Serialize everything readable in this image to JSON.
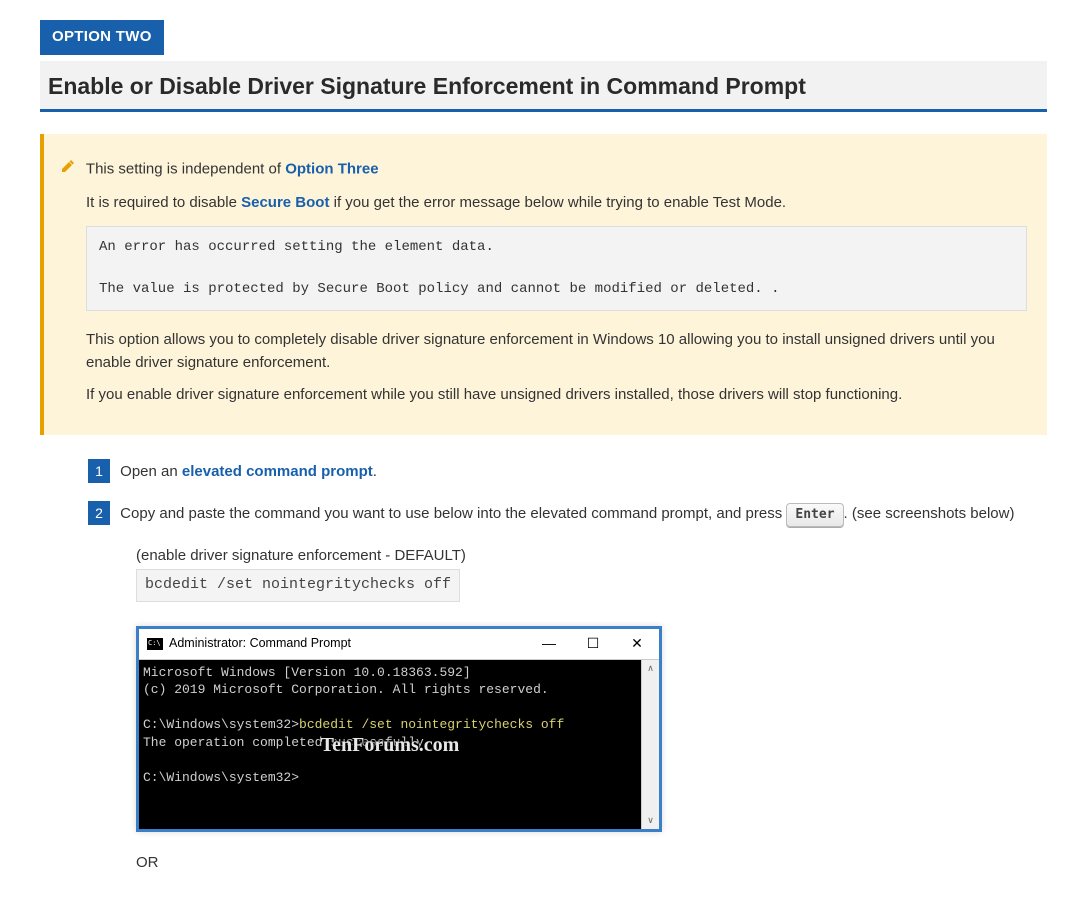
{
  "optionTag": "OPTION TWO",
  "heading": "Enable or Disable Driver Signature Enforcement in Command Prompt",
  "note": {
    "line1_a": "This setting is independent of ",
    "line1_link": "Option Three",
    "line2_a": "It is required to disable ",
    "line2_link": "Secure Boot",
    "line2_b": " if you get the error message below while trying to enable Test Mode.",
    "errorBox": "An error has occurred setting the element data.\n\nThe value is protected by Secure Boot policy and cannot be modified or deleted. .",
    "line3": "This option allows you to completely disable driver signature enforcement in Windows 10 allowing you to install unsigned drivers until you enable driver signature enforcement.",
    "line4": "If you enable driver signature enforcement while you still have unsigned drivers installed, those drivers will stop functioning."
  },
  "steps": {
    "s1_num": "1",
    "s1_a": "Open an ",
    "s1_link": "elevated command prompt",
    "s1_b": ".",
    "s2_num": "2",
    "s2_a": "Copy and paste the command you want to use below into the elevated command prompt, and press ",
    "s2_key": "Enter",
    "s2_b": ". (see screenshots below)"
  },
  "command1": {
    "label": "(enable driver signature enforcement - DEFAULT)",
    "code": "bcdedit /set nointegritychecks off"
  },
  "cmdWindow": {
    "title": "Administrator: Command Prompt",
    "line1": "Microsoft Windows [Version 10.0.18363.592]",
    "line2": "(c) 2019 Microsoft Corporation. All rights reserved.",
    "prompt1": "C:\\Windows\\system32>",
    "cmd": "bcdedit /set nointegritychecks off",
    "result": "The operation completed successfully.",
    "prompt2": "C:\\Windows\\system32>",
    "watermark": "TenForums.com"
  },
  "orText": "OR"
}
